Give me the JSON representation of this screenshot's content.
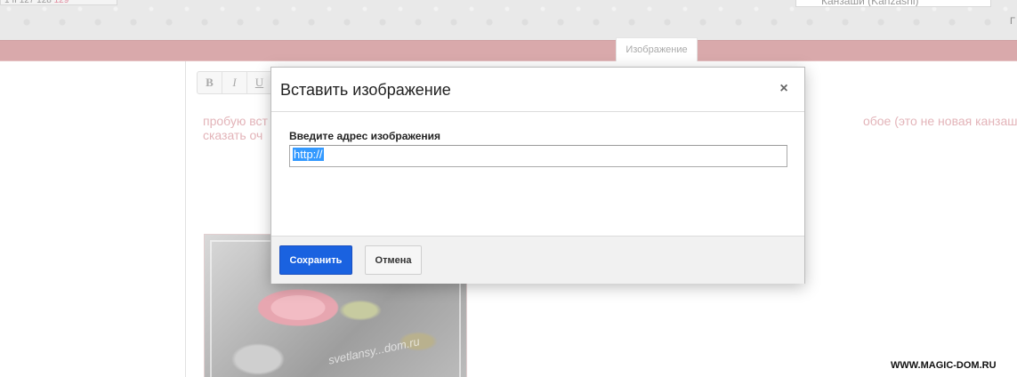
{
  "background": {
    "top_left_fragment": [
      "1",
      "II",
      "127",
      "128",
      "129"
    ],
    "top_right_fragment": "Канзаши (Kanzashi)",
    "top_right_letter": "Г",
    "tooltip": "Изображение",
    "toolbar": {
      "bold": "B",
      "italic": "I",
      "underline": "U"
    },
    "post_text": {
      "line1_start": "пробую вст",
      "line1_end": "обое (это не новая канзашка, для",
      "line2": "сказать оч"
    },
    "photo_watermark": "svetlansy...dom.ru",
    "site_watermark": "WWW.MAGIC-DOM.RU"
  },
  "dialog": {
    "title": "Вставить изображение",
    "close_glyph": "×",
    "field_label": "Введите адрес изображения",
    "url_value": "http://",
    "save_label": "Сохранить",
    "cancel_label": "Отмена"
  },
  "colors": {
    "save_button": "#1a62e0",
    "pink_strip": "#d9a9ab",
    "selection": "#3399ff"
  }
}
